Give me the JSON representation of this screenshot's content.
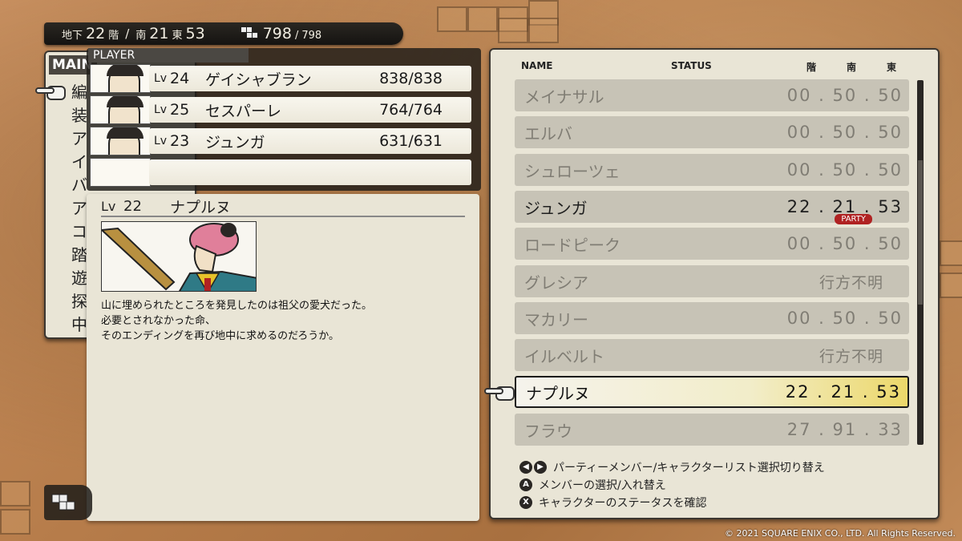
{
  "location": {
    "basement_label": "地下",
    "floor": "22",
    "floor_unit": "階",
    "separator": "/",
    "south_label": "南",
    "south": "21",
    "east_label": "東",
    "east": "53",
    "hp_current": "798",
    "hp_separator": "/",
    "hp_max": "798"
  },
  "main_menu": {
    "title": "MAIN",
    "items": [
      "編",
      "装",
      "ア",
      "イ",
      "バ",
      "ア",
      "コ",
      "踏",
      "遊",
      "探",
      "中"
    ]
  },
  "player": {
    "tab_label": "PLAYER",
    "rows": [
      {
        "lv_label": "Lv",
        "lv": "24",
        "name": "ゲイシャブラン",
        "hp": "838/838"
      },
      {
        "lv_label": "Lv",
        "lv": "25",
        "name": "セスパーレ",
        "hp": "764/764"
      },
      {
        "lv_label": "Lv",
        "lv": "23",
        "name": "ジュンガ",
        "hp": "631/631"
      },
      {
        "lv_label": "",
        "lv": "",
        "name": "",
        "hp": ""
      }
    ]
  },
  "detail": {
    "lv_label": "Lv",
    "lv": "22",
    "name": "ナプルヌ",
    "description": [
      "山に埋められたところを発見したのは祖父の愛犬だった。",
      "必要とされなかった命、",
      "そのエンディングを再び地中に求めるのだろうか。"
    ]
  },
  "list": {
    "headers": {
      "name": "NAME",
      "status": "STATUS",
      "floor": "階",
      "south": "南",
      "east": "東"
    },
    "party_badge": "PARTY",
    "rows": [
      {
        "name": "メイナサル",
        "status": "00 . 50 . 50",
        "state": "normal"
      },
      {
        "name": "エルバ",
        "status": "00 . 50 . 50",
        "state": "normal"
      },
      {
        "name": "シュローツェ",
        "status": "00 . 50 . 50",
        "state": "normal"
      },
      {
        "name": "ジュンガ",
        "status": "22 . 21 . 53",
        "state": "party"
      },
      {
        "name": "ロードピーク",
        "status": "00 . 50 . 50",
        "state": "normal"
      },
      {
        "name": "グレシア",
        "status": "行方不明",
        "state": "lost"
      },
      {
        "name": "マカリー",
        "status": "00 . 50 . 50",
        "state": "normal"
      },
      {
        "name": "イルベルト",
        "status": "行方不明",
        "state": "lost"
      },
      {
        "name": "ナプルヌ",
        "status": "22 . 21 . 53",
        "state": "selected"
      },
      {
        "name": "フラウ",
        "status": "27 . 91 . 33",
        "state": "normal"
      }
    ]
  },
  "hints": {
    "toggle_buttons": [
      "◀",
      "▶"
    ],
    "toggle_label": "パーティーメンバー/キャラクターリスト選択切り替え",
    "a_button": "A",
    "a_label": "メンバーの選択/入れ替え",
    "x_button": "X",
    "x_label": "キャラクターのステータスを確認"
  },
  "copyright": "© 2021 SQUARE ENIX CO., LTD. All Rights Reserved."
}
